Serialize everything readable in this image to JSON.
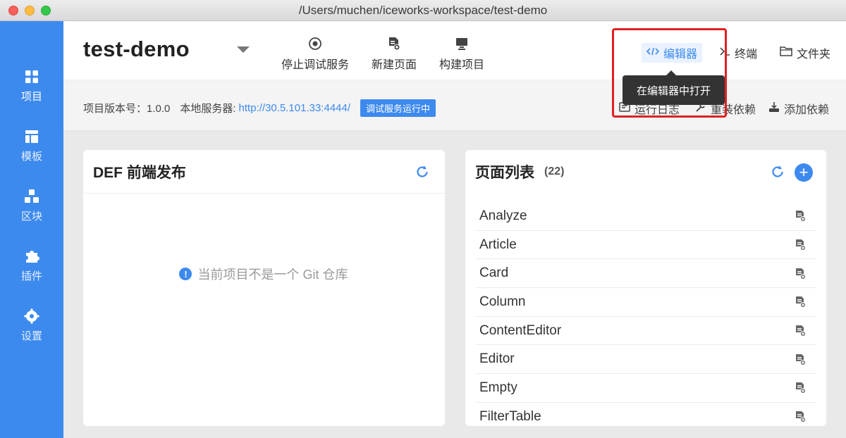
{
  "window": {
    "title": "/Users/muchen/iceworks-workspace/test-demo"
  },
  "sidebar": {
    "items": [
      {
        "label": "项目",
        "icon": "grid-icon"
      },
      {
        "label": "模板",
        "icon": "layout-icon"
      },
      {
        "label": "区块",
        "icon": "blocks-icon"
      },
      {
        "label": "插件",
        "icon": "puzzle-icon"
      },
      {
        "label": "设置",
        "icon": "gear-icon"
      }
    ]
  },
  "header": {
    "project_name": "test-demo",
    "actions": [
      {
        "label": "停止调试服务",
        "icon": "stop-circle-icon"
      },
      {
        "label": "新建页面",
        "icon": "new-page-icon"
      },
      {
        "label": "构建项目",
        "icon": "monitor-icon"
      }
    ],
    "tools": [
      {
        "label": "编辑器",
        "icon": "code-icon"
      },
      {
        "label": "终端",
        "icon": "terminal-icon"
      },
      {
        "label": "文件夹",
        "icon": "folder-icon"
      }
    ]
  },
  "infobar": {
    "version_label": "项目版本号：1.0.0",
    "server_label": "本地服务器:",
    "server_url": "http://30.5.101.33:4444/",
    "status_badge": "调试服务运行中",
    "tools": [
      {
        "label": "运行日志",
        "icon": "log-icon"
      },
      {
        "label": "重装依赖",
        "icon": "wrench-icon"
      },
      {
        "label": "添加依赖",
        "icon": "download-icon"
      }
    ]
  },
  "tooltip": {
    "text": "在编辑器中打开"
  },
  "def_card": {
    "title": "DEF 前端发布",
    "empty_message": "当前项目不是一个 Git 仓库"
  },
  "pages_card": {
    "title": "页面列表",
    "count": "(22)",
    "pages": [
      "Analyze",
      "Article",
      "Card",
      "Column",
      "ContentEditor",
      "Editor",
      "Empty",
      "FilterTable"
    ]
  },
  "colors": {
    "accent": "#3d8aef",
    "highlight": "#e02020",
    "tooltip_bg": "#333333"
  }
}
